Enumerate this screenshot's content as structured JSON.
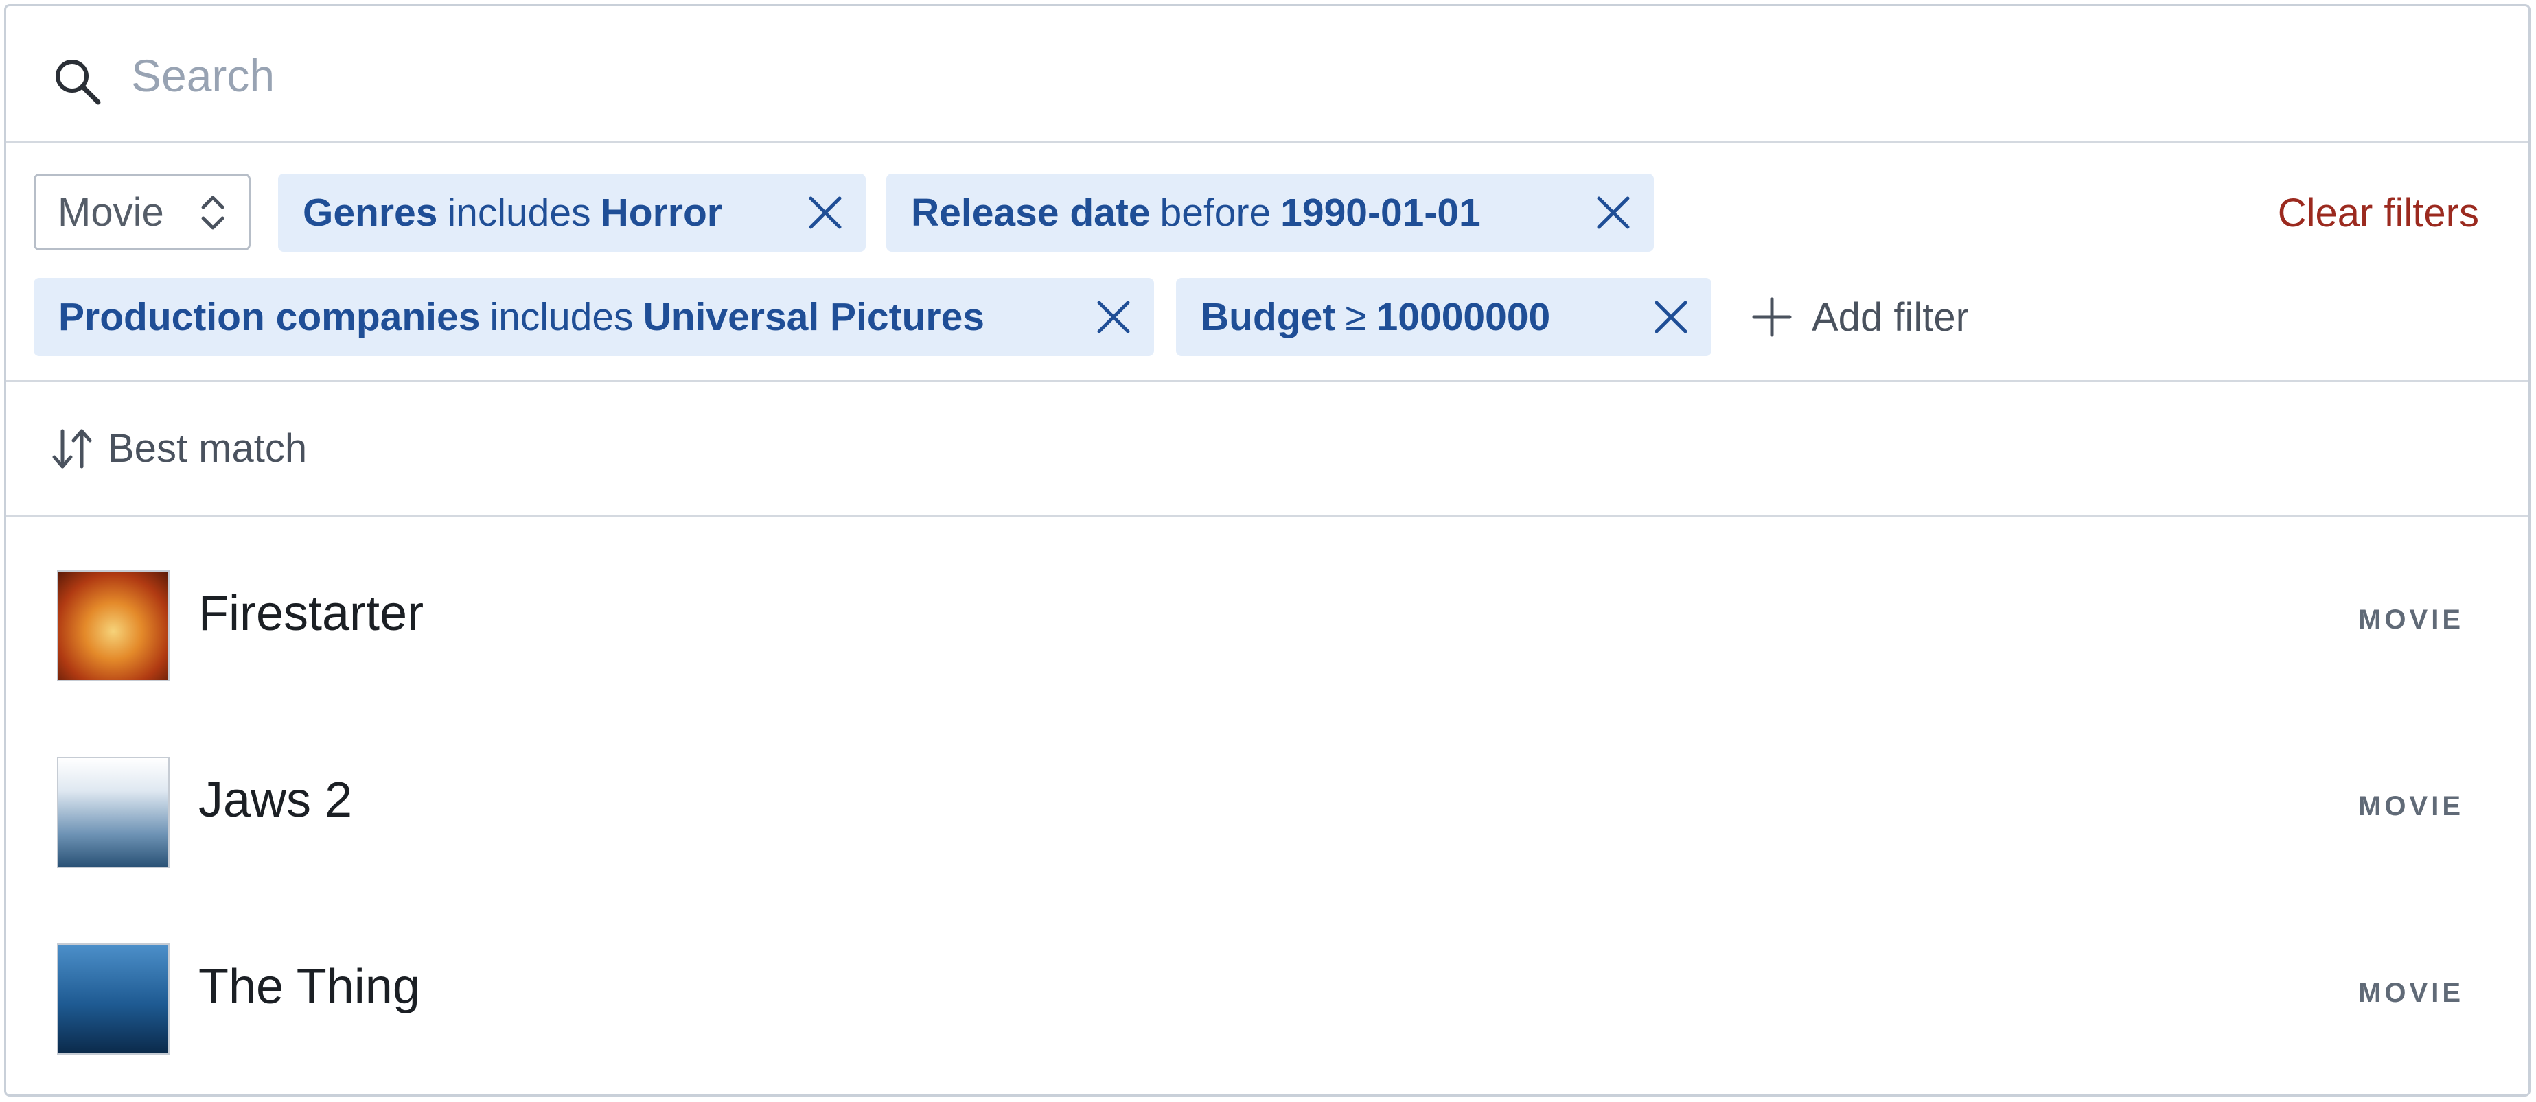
{
  "search": {
    "placeholder": "Search",
    "value": ""
  },
  "type_select": {
    "value": "Movie"
  },
  "filters": [
    {
      "field": "Genres",
      "operator": "includes",
      "value": "Horror"
    },
    {
      "field": "Release date",
      "operator": "before",
      "value": "1990-01-01"
    },
    {
      "field": "Production companies",
      "operator": "includes",
      "value": "Universal Pictures"
    },
    {
      "field": "Budget",
      "operator": "≥",
      "value": "10000000"
    }
  ],
  "add_filter_label": "Add filter",
  "clear_filters_label": "Clear filters",
  "sort": {
    "label": "Best match"
  },
  "results": [
    {
      "title": "Firestarter",
      "kind": "MOVIE"
    },
    {
      "title": "Jaws 2",
      "kind": "MOVIE"
    },
    {
      "title": "The Thing",
      "kind": "MOVIE"
    }
  ],
  "colors": {
    "chip_bg": "#e3edfa",
    "chip_text": "#1f4e96",
    "clear_filters": "#9b2a1f",
    "border": "#c9d0d9"
  }
}
